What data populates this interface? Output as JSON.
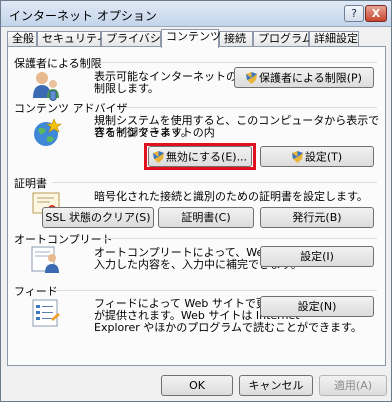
{
  "window": {
    "title": "インターネット オプション",
    "help_label": "?",
    "close_label": "X"
  },
  "tabs": [
    {
      "label": "全般",
      "active": false
    },
    {
      "label": "セキュリティ",
      "active": false
    },
    {
      "label": "プライバシー",
      "active": false
    },
    {
      "label": "コンテンツ",
      "active": true
    },
    {
      "label": "接続",
      "active": false
    },
    {
      "label": "プログラム",
      "active": false
    },
    {
      "label": "詳細設定",
      "active": false
    }
  ],
  "parental": {
    "heading": "保護者による制限",
    "desc_line1": "表示可能なインターネットのコンテンツを",
    "desc_line2": "制限します。",
    "button": "保護者による制限(P)",
    "icon": "parental-controls-icon"
  },
  "advisor": {
    "heading": "コンテンツ アドバイザ",
    "desc_line1": "規制システムを使用すると、このコンピュータから表示できるインターネットの内",
    "desc_line2": "容を制御できます。",
    "disable_button": "無効にする(E)...",
    "settings_button": "設定(T)",
    "icon": "globe-star-icon",
    "highlight_color": "#e0101c"
  },
  "certificates": {
    "heading": "証明書",
    "desc": "暗号化された接続と識別のための証明書を設定します。",
    "ssl_button": "SSL 状態のクリア(S)",
    "cert_button": "証明書(C)",
    "publisher_button": "発行元(B)",
    "icon": "certificate-icon"
  },
  "autocomplete": {
    "heading": "オートコンプリート",
    "desc_line1": "オートコンプリートによって、Web ページで前回",
    "desc_line2": "入力した内容を、入力中に補完できます。",
    "button": "設定(I)",
    "icon": "autocomplete-icon"
  },
  "feeds": {
    "heading": "フィード",
    "desc_line1": "フィードによって Web サイトで更新された内容",
    "desc_line2": "が提供されます。Web サイトは Internet",
    "desc_line3": "Explorer やほかのプログラムで読むことができます。",
    "button": "設定(N)",
    "icon": "feed-list-icon"
  },
  "footer": {
    "ok": "OK",
    "cancel": "キャンセル",
    "apply": "適用(A)"
  }
}
